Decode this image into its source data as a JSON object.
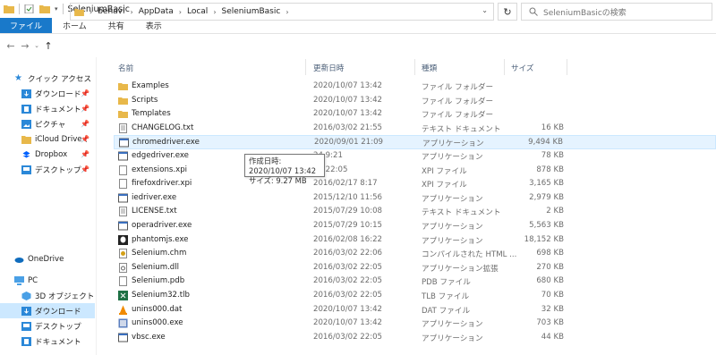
{
  "window": {
    "title": "SeleniumBasic"
  },
  "ribbon": {
    "tabs": [
      "ファイル",
      "ホーム",
      "共有",
      "表示"
    ]
  },
  "address": {
    "crumbs": [
      "benavi",
      "AppData",
      "Local",
      "SeleniumBasic"
    ],
    "search_placeholder": "SeleniumBasicの検索"
  },
  "nav": {
    "quick_access": "クイック アクセス",
    "items": [
      {
        "label": "ダウンロード",
        "icon": "download-folder-icon",
        "pinned": true
      },
      {
        "label": "ドキュメント",
        "icon": "documents-icon",
        "pinned": true
      },
      {
        "label": "ピクチャ",
        "icon": "pictures-icon",
        "pinned": true
      },
      {
        "label": "iCloud Drive (",
        "icon": "icloud-icon",
        "pinned": true
      },
      {
        "label": "Dropbox",
        "icon": "dropbox-icon",
        "pinned": true
      },
      {
        "label": "デスクトップ",
        "icon": "desktop-folder-icon",
        "pinned": true
      }
    ],
    "onedrive": "OneDrive",
    "pc": "PC",
    "pc_items": [
      {
        "label": "3D オブジェクト",
        "icon": "3d-objects-icon"
      },
      {
        "label": "ダウンロード",
        "icon": "download-folder-icon"
      },
      {
        "label": "デスクトップ",
        "icon": "desktop-folder-icon"
      },
      {
        "label": "ドキュメント",
        "icon": "documents-icon"
      }
    ]
  },
  "columns": {
    "name": "名前",
    "date": "更新日時",
    "type": "種類",
    "size": "サイズ"
  },
  "files": [
    {
      "name": "Examples",
      "date": "2020/10/07 13:42",
      "type": "ファイル フォルダー",
      "size": "",
      "icon": "folder-icon"
    },
    {
      "name": "Scripts",
      "date": "2020/10/07 13:42",
      "type": "ファイル フォルダー",
      "size": "",
      "icon": "folder-icon"
    },
    {
      "name": "Templates",
      "date": "2020/10/07 13:42",
      "type": "ファイル フォルダー",
      "size": "",
      "icon": "folder-icon"
    },
    {
      "name": "CHANGELOG.txt",
      "date": "2016/03/02 21:55",
      "type": "テキスト ドキュメント",
      "size": "16 KB",
      "icon": "text-file-icon"
    },
    {
      "name": "chromedriver.exe",
      "date": "2020/09/01 21:09",
      "type": "アプリケーション",
      "size": "9,494 KB",
      "icon": "exe-icon"
    },
    {
      "name": "edgedriver.exe",
      "date": "24 9:21",
      "type": "アプリケーション",
      "size": "78 KB",
      "icon": "exe-icon"
    },
    {
      "name": "extensions.xpi",
      "date": "02 22:05",
      "type": "XPI ファイル",
      "size": "878 KB",
      "icon": "file-icon"
    },
    {
      "name": "firefoxdriver.xpi",
      "date": "2016/02/17 8:17",
      "type": "XPI ファイル",
      "size": "3,165 KB",
      "icon": "file-icon"
    },
    {
      "name": "iedriver.exe",
      "date": "2015/12/10 11:56",
      "type": "アプリケーション",
      "size": "2,979 KB",
      "icon": "exe-icon"
    },
    {
      "name": "LICENSE.txt",
      "date": "2015/07/29 10:08",
      "type": "テキスト ドキュメント",
      "size": "2 KB",
      "icon": "text-file-icon"
    },
    {
      "name": "operadriver.exe",
      "date": "2015/07/29 10:15",
      "type": "アプリケーション",
      "size": "5,563 KB",
      "icon": "exe-icon"
    },
    {
      "name": "phantomjs.exe",
      "date": "2016/02/08 16:22",
      "type": "アプリケーション",
      "size": "18,152 KB",
      "icon": "phantom-icon"
    },
    {
      "name": "Selenium.chm",
      "date": "2016/03/02 22:06",
      "type": "コンパイルされた HTML ...",
      "size": "698 KB",
      "icon": "help-file-icon"
    },
    {
      "name": "Selenium.dll",
      "date": "2016/03/02 22:05",
      "type": "アプリケーション拡張",
      "size": "270 KB",
      "icon": "dll-icon"
    },
    {
      "name": "Selenium.pdb",
      "date": "2016/03/02 22:05",
      "type": "PDB ファイル",
      "size": "680 KB",
      "icon": "file-icon"
    },
    {
      "name": "Selenium32.tlb",
      "date": "2016/03/02 22:05",
      "type": "TLB ファイル",
      "size": "70 KB",
      "icon": "excel-icon"
    },
    {
      "name": "unins000.dat",
      "date": "2020/10/07 13:42",
      "type": "DAT ファイル",
      "size": "32 KB",
      "icon": "vlc-icon"
    },
    {
      "name": "unins000.exe",
      "date": "2020/10/07 13:42",
      "type": "アプリケーション",
      "size": "703 KB",
      "icon": "installer-icon"
    },
    {
      "name": "vbsc.exe",
      "date": "2016/03/02 22:05",
      "type": "アプリケーション",
      "size": "44 KB",
      "icon": "exe-icon"
    }
  ],
  "tooltip": {
    "line1": "作成日時: 2020/10/07 13:42",
    "line2": "サイズ: 9.27 MB"
  },
  "colors": {
    "accent": "#1979ca",
    "selection": "#cce8ff",
    "hover": "#e5f3ff",
    "folder": "#e8b84a"
  }
}
